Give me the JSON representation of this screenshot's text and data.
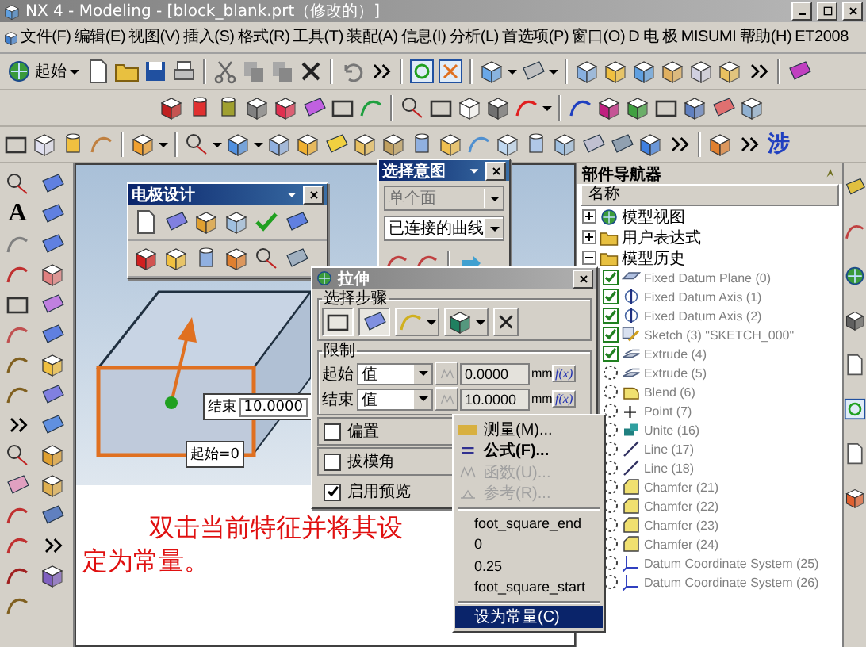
{
  "window": {
    "title": "NX 4 - Modeling - [block_blank.prt（修改的）]"
  },
  "menu": [
    "文件(F)",
    "编辑(E)",
    "视图(V)",
    "插入(S)",
    "格式(R)",
    "工具(T)",
    "装配(A)",
    "信息(I)",
    "分析(L)",
    "首选项(P)",
    "窗口(O)",
    "D 电",
    "极",
    "MISUMI",
    "帮助(H)",
    "ET2008"
  ],
  "toolbar": {
    "start_button": "起始",
    "glyph": "涉"
  },
  "left_palette": {
    "text_tool": "A"
  },
  "electrode_panel": {
    "title": "电极设计"
  },
  "selection_intent": {
    "title": "选择意图",
    "face_rule": {
      "value": "单个面",
      "disabled": true
    },
    "curve_rule": {
      "value": "已连接的曲线",
      "disabled": false
    }
  },
  "extrude_dialog": {
    "title": "拉伸",
    "steps_label": "选择步骤",
    "limits_label": "限制",
    "limits": [
      {
        "label": "起始",
        "type": "值",
        "value": "0.0000",
        "unit": "mm",
        "formula_button": "f(x)"
      },
      {
        "label": "结束",
        "type": "值",
        "value": "10.0000",
        "unit": "mm",
        "formula_button": "f(x)"
      }
    ],
    "options": [
      {
        "label": "偏置",
        "checked": false
      },
      {
        "label": "拔模角",
        "checked": false
      },
      {
        "label": "启用预览",
        "checked": true
      }
    ]
  },
  "context_menu": {
    "items": [
      {
        "kind": "command",
        "label": "测量(M)...",
        "disabled": false,
        "default": false,
        "selected": false
      },
      {
        "kind": "command",
        "label": "公式(F)...",
        "disabled": false,
        "default": true,
        "selected": false
      },
      {
        "kind": "command",
        "label": "函数(U)...",
        "disabled": true,
        "default": false,
        "selected": false
      },
      {
        "kind": "command",
        "label": "参考(R)...",
        "disabled": true,
        "default": false,
        "selected": false
      },
      {
        "kind": "expression",
        "label": "foot_square_end",
        "disabled": false,
        "default": false,
        "selected": false
      },
      {
        "kind": "expression",
        "label": "0",
        "disabled": false,
        "default": false,
        "selected": false
      },
      {
        "kind": "expression",
        "label": "0.25",
        "disabled": false,
        "default": false,
        "selected": false
      },
      {
        "kind": "expression",
        "label": "foot_square_start",
        "disabled": false,
        "default": false,
        "selected": false
      },
      {
        "kind": "action",
        "label": "设为常量(C)",
        "disabled": false,
        "default": false,
        "selected": true
      }
    ]
  },
  "viewport": {
    "end_label": "结束",
    "end_value": "10.0000",
    "start_label": "起始=0"
  },
  "note": {
    "lines": [
      "双击当前特征并将其设",
      "定为常量。"
    ]
  },
  "part_navigator": {
    "title": "部件导航器",
    "column": "名称",
    "tree": [
      {
        "label": "模型视图",
        "expanded": false
      },
      {
        "label": "用户表达式",
        "expanded": false
      },
      {
        "label": "模型历史",
        "expanded": true,
        "children": [
          {
            "kind": "datum_plane",
            "label": "Fixed Datum Plane (0)",
            "checked": true
          },
          {
            "kind": "datum_axis",
            "label": "Fixed Datum Axis (1)",
            "checked": true
          },
          {
            "kind": "datum_axis",
            "label": "Fixed Datum Axis (2)",
            "checked": true
          },
          {
            "kind": "sketch",
            "label": "Sketch (3) \"SKETCH_000\"",
            "checked": true
          },
          {
            "kind": "extrude",
            "label": "Extrude (4)",
            "checked": true
          },
          {
            "kind": "extrude",
            "label": "Extrude (5)",
            "checked": false
          },
          {
            "kind": "blend",
            "label": "Blend (6)",
            "checked": false
          },
          {
            "kind": "point",
            "label": "Point (7)",
            "checked": false
          },
          {
            "kind": "unite",
            "label": "Unite (16)",
            "checked": false
          },
          {
            "kind": "line",
            "label": "Line (17)",
            "checked": false
          },
          {
            "kind": "line",
            "label": "Line (18)",
            "checked": false
          },
          {
            "kind": "chamfer",
            "label": "Chamfer (21)",
            "checked": false
          },
          {
            "kind": "chamfer",
            "label": "Chamfer (22)",
            "checked": false
          },
          {
            "kind": "chamfer",
            "label": "Chamfer (23)",
            "checked": false
          },
          {
            "kind": "chamfer",
            "label": "Chamfer (24)",
            "checked": false
          },
          {
            "kind": "csys",
            "label": "Datum Coordinate System (25)",
            "checked": false
          },
          {
            "kind": "csys",
            "label": "Datum Coordinate System (26)",
            "checked": false
          }
        ]
      }
    ]
  }
}
